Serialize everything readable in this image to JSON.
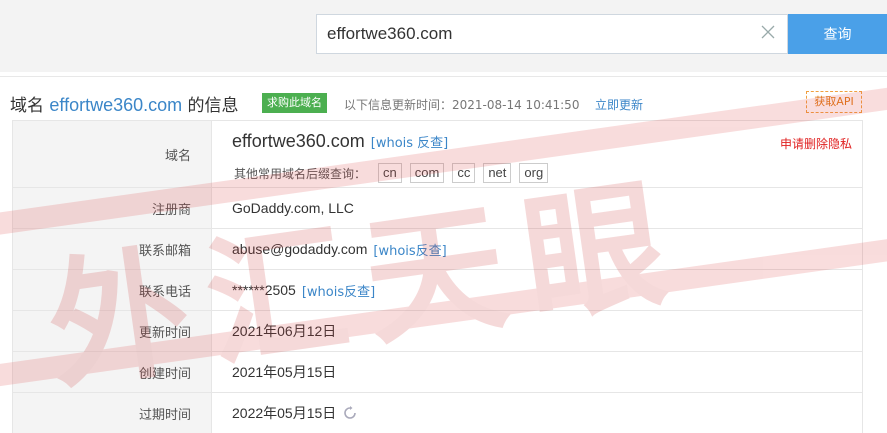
{
  "search": {
    "value": "effortwe360.com",
    "button_label": "查询"
  },
  "heading": {
    "prefix": "域名 ",
    "domain": "effortwe360.com",
    "suffix": " 的信息",
    "buy_badge": "求购此域名",
    "update_text": "以下信息更新时间：2021-08-14 10:41:50",
    "update_link": "立即更新",
    "api_button": "获取API"
  },
  "domain_row": {
    "label": "域名",
    "domain": "effortwe360.com",
    "whois_link": "[whois 反查]",
    "privacy_link": "申请删除隐私",
    "suffix_label": "其他常用域名后缀查询：",
    "suffixes": [
      "cn",
      "com",
      "cc",
      "net",
      "org"
    ]
  },
  "rows": [
    {
      "label": "注册商",
      "value": "GoDaddy.com, LLC",
      "link": ""
    },
    {
      "label": "联系邮箱",
      "value": "abuse@godaddy.com",
      "link": "[whois反查]"
    },
    {
      "label": "联系电话",
      "value": "******2505",
      "link": "[whois反查]"
    },
    {
      "label": "更新时间",
      "value": "2021年06月12日",
      "link": ""
    },
    {
      "label": "创建时间",
      "value": "2021年05月15日",
      "link": ""
    },
    {
      "label": "过期时间",
      "value": "2022年05月15日",
      "link": ""
    }
  ],
  "watermark": {
    "text": "外汇天眼"
  },
  "icons": {
    "clear": "close-icon",
    "refresh": "refresh-icon"
  },
  "colors": {
    "accent": "#4aa0e8",
    "link": "#3b86c8",
    "badge": "#4caf50",
    "warning": "#e02020",
    "api": "#e07b18"
  }
}
